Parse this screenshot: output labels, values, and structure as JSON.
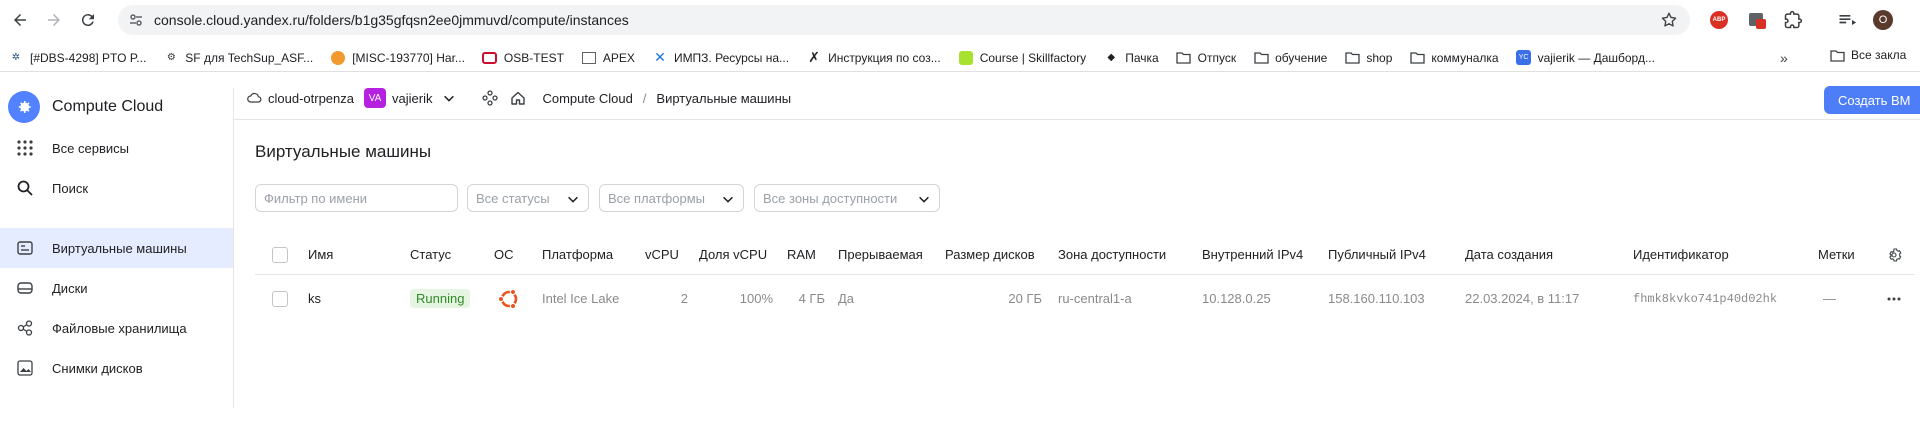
{
  "browser": {
    "url": "console.cloud.yandex.ru/folders/b1g35gfqsn2ee0jmmuvd/compute/instances",
    "abp_label": "ABP",
    "avatar_letter": "O"
  },
  "bookmarks": [
    {
      "label": "[#DBS-4298] PTO P...",
      "icon": "fork-icon"
    },
    {
      "label": "SF для TechSup_ASF...",
      "icon": "sf-icon"
    },
    {
      "label": "[MISC-193770] Нar...",
      "icon": "orange-icon"
    },
    {
      "label": "OSB-TEST",
      "icon": "red-square-icon"
    },
    {
      "label": "APEX",
      "icon": "apex-icon"
    },
    {
      "label": "ИМПЗ. Ресурсы на...",
      "icon": "impz-icon"
    },
    {
      "label": "Инструкция по соз...",
      "icon": "x-icon"
    },
    {
      "label": "Course | Skillfactory",
      "icon": "skillfactory-icon"
    },
    {
      "label": "Пачка",
      "icon": "stack-icon"
    },
    {
      "label": "Отпуск",
      "icon": "folder-icon"
    },
    {
      "label": "обучение",
      "icon": "folder-icon"
    },
    {
      "label": "shop",
      "icon": "folder-icon"
    },
    {
      "label": "коммуналка",
      "icon": "folder-icon"
    },
    {
      "label": "vajierik — Дашборд...",
      "icon": "yc-icon"
    }
  ],
  "bookmarks_right": {
    "label": "Все закла"
  },
  "sidebar": {
    "title": "Compute Cloud",
    "top_items": [
      {
        "label": "Все сервисы",
        "icon": "grid-icon"
      },
      {
        "label": "Поиск",
        "icon": "search-icon"
      }
    ],
    "items": [
      {
        "label": "Виртуальные машины",
        "icon": "vm-icon",
        "active": true
      },
      {
        "label": "Диски",
        "icon": "disk-icon"
      },
      {
        "label": "Файловые хранилища",
        "icon": "filestore-icon"
      },
      {
        "label": "Снимки дисков",
        "icon": "snapshot-icon"
      }
    ]
  },
  "breadcrumb": {
    "cloud": "cloud-otrpenza",
    "folder_badge": "VA",
    "folder": "vajierik",
    "service": "Compute Cloud",
    "separator": "/",
    "current": "Виртуальные машины"
  },
  "create_button": "Создать ВМ",
  "page_title": "Виртуальные машины",
  "filters": {
    "name_placeholder": "Фильтр по имени",
    "status": "Все статусы",
    "platform": "Все платформы",
    "zone": "Все зоны доступности"
  },
  "table": {
    "headers": {
      "name": "Имя",
      "status": "Статус",
      "os": "ОС",
      "platform": "Платформа",
      "vcpu": "vCPU",
      "vcpu_share": "Доля vCPU",
      "ram": "RAM",
      "preemptible": "Прерываемая",
      "disk_size": "Размер дисков",
      "zone": "Зона доступности",
      "internal_ip": "Внутренний IPv4",
      "public_ip": "Публичный IPv4",
      "created": "Дата создания",
      "id": "Идентификатор",
      "labels": "Метки"
    },
    "rows": [
      {
        "name": "ks",
        "status": "Running",
        "os_icon": "ubuntu-icon",
        "platform": "Intel Ice Lake",
        "vcpu": "2",
        "vcpu_share": "100%",
        "ram": "4 ГБ",
        "preemptible": "Да",
        "disk_size": "20 ГБ",
        "zone": "ru-central1-a",
        "internal_ip": "10.128.0.25",
        "public_ip": "158.160.110.103",
        "created": "22.03.2024, в 11:17",
        "id": "fhmk8kvko741p40d02hk",
        "labels": "—"
      }
    ]
  },
  "colors": {
    "accent": "#4d7ef7",
    "sidebar_active": "#e6ecff",
    "status_running_bg": "#e6f5e1",
    "status_running_text": "#2f8a2a",
    "folder_badge": "#b620e0",
    "ubuntu": "#e95420"
  }
}
